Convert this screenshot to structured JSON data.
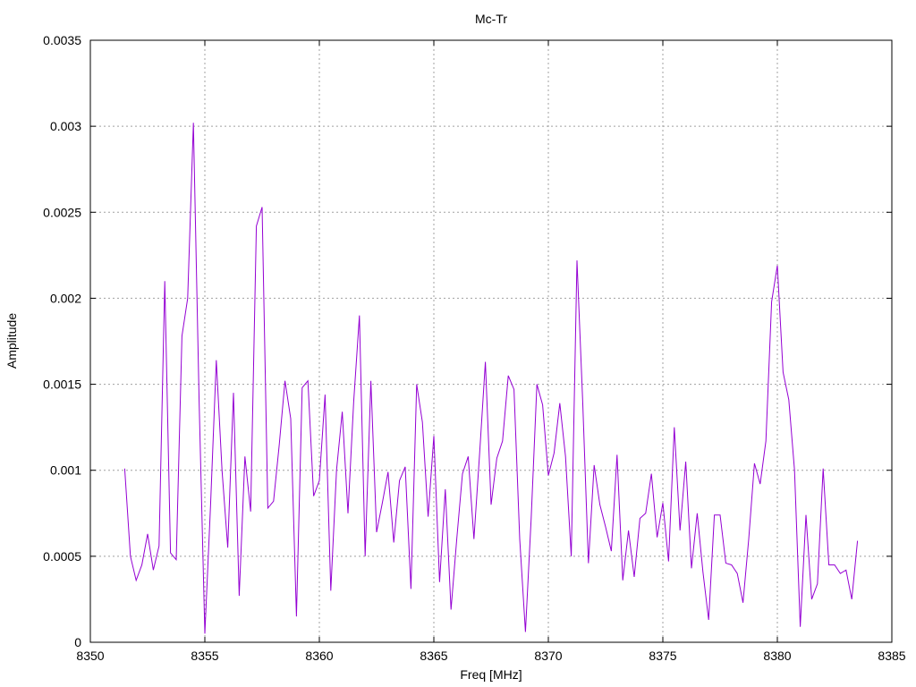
{
  "chart_data": {
    "type": "line",
    "title": "Mc-Tr",
    "xlabel": "Freq [MHz]",
    "ylabel": "Amplitude",
    "xlim": [
      8350,
      8385
    ],
    "ylim": [
      0,
      0.0035
    ],
    "x_ticks": [
      "8350",
      "8355",
      "8360",
      "8365",
      "8370",
      "8375",
      "8380",
      "8385"
    ],
    "y_ticks": [
      "0",
      "0.0005",
      "0.001",
      "0.0015",
      "0.002",
      "0.0025",
      "0.003",
      "0.0035"
    ],
    "grid": true,
    "line_color": "#9400d3",
    "series": [
      {
        "x": [
          8351.5,
          8351.75,
          8352.0,
          8352.25,
          8352.5,
          8352.75,
          8353.0,
          8353.25,
          8353.5,
          8353.75,
          8354.0,
          8354.25,
          8354.5,
          8354.75,
          8355.0,
          8355.25,
          8355.5,
          8355.75,
          8356.0,
          8356.25,
          8356.5,
          8356.75,
          8357.0,
          8357.25,
          8357.5,
          8357.75,
          8358.0,
          8358.25,
          8358.5,
          8358.75,
          8359.0,
          8359.25,
          8359.5,
          8359.75,
          8360.0,
          8360.25,
          8360.5,
          8360.75,
          8361.0,
          8361.25,
          8361.5,
          8361.75,
          8362.0,
          8362.25,
          8362.5,
          8362.75,
          8363.0,
          8363.25,
          8363.5,
          8363.75,
          8364.0,
          8364.25,
          8364.5,
          8364.75,
          8365.0,
          8365.25,
          8365.5,
          8365.75,
          8366.0,
          8366.25,
          8366.5,
          8366.75,
          8367.0,
          8367.25,
          8367.5,
          8367.75,
          8368.0,
          8368.25,
          8368.5,
          8368.75,
          8369.0,
          8369.25,
          8369.5,
          8369.75,
          8370.0,
          8370.25,
          8370.5,
          8370.75,
          8371.0,
          8371.25,
          8371.5,
          8371.75,
          8372.0,
          8372.25,
          8372.5,
          8372.75,
          8373.0,
          8373.25,
          8373.5,
          8373.75,
          8374.0,
          8374.25,
          8374.5,
          8374.75,
          8375.0,
          8375.25,
          8375.5,
          8375.75,
          8376.0,
          8376.25,
          8376.5,
          8376.75,
          8377.0,
          8377.25,
          8377.5,
          8377.75,
          8378.0,
          8378.25,
          8378.5,
          8378.75,
          8379.0,
          8379.25,
          8379.5,
          8379.75,
          8380.0,
          8380.25,
          8380.5,
          8380.75,
          8381.0,
          8381.25,
          8381.5,
          8381.75,
          8382.0,
          8382.25,
          8382.5,
          8382.75,
          8383.0,
          8383.25,
          8383.5
        ],
        "y": [
          0.00101,
          0.0005,
          0.00036,
          0.00045,
          0.00063,
          0.00042,
          0.00056,
          0.0021,
          0.00052,
          0.00048,
          0.00178,
          0.002,
          0.00302,
          0.0014,
          5e-05,
          0.0008,
          0.00164,
          0.001,
          0.00055,
          0.00145,
          0.00027,
          0.00108,
          0.00076,
          0.00242,
          0.00253,
          0.00078,
          0.00082,
          0.00115,
          0.00152,
          0.0013,
          0.00015,
          0.00148,
          0.00152,
          0.00085,
          0.00094,
          0.00144,
          0.0003,
          0.001,
          0.00134,
          0.00075,
          0.0014,
          0.0019,
          0.0005,
          0.00152,
          0.00064,
          0.00081,
          0.00099,
          0.00058,
          0.00094,
          0.00102,
          0.00031,
          0.0015,
          0.00128,
          0.00073,
          0.0012,
          0.00035,
          0.00089,
          0.00019,
          0.0006,
          0.00098,
          0.00108,
          0.0006,
          0.0011,
          0.00163,
          0.0008,
          0.00107,
          0.00117,
          0.00155,
          0.00147,
          0.0006,
          6e-05,
          0.00072,
          0.0015,
          0.00138,
          0.00097,
          0.0011,
          0.00139,
          0.00108,
          0.0005,
          0.00222,
          0.0014,
          0.00046,
          0.00103,
          0.0008,
          0.00067,
          0.00053,
          0.00109,
          0.00036,
          0.00065,
          0.00038,
          0.00072,
          0.00075,
          0.00098,
          0.00061,
          0.00081,
          0.00047,
          0.00125,
          0.00065,
          0.00105,
          0.00043,
          0.00075,
          0.00041,
          0.00013,
          0.00074,
          0.00074,
          0.00046,
          0.00045,
          0.0004,
          0.00023,
          0.0006,
          0.00104,
          0.00092,
          0.00117,
          0.00198,
          0.00219,
          0.00157,
          0.00141,
          0.001,
          9e-05,
          0.00074,
          0.00025,
          0.00034,
          0.00101,
          0.00045,
          0.00045,
          0.0004,
          0.00042,
          0.00025,
          0.00059
        ]
      }
    ]
  }
}
